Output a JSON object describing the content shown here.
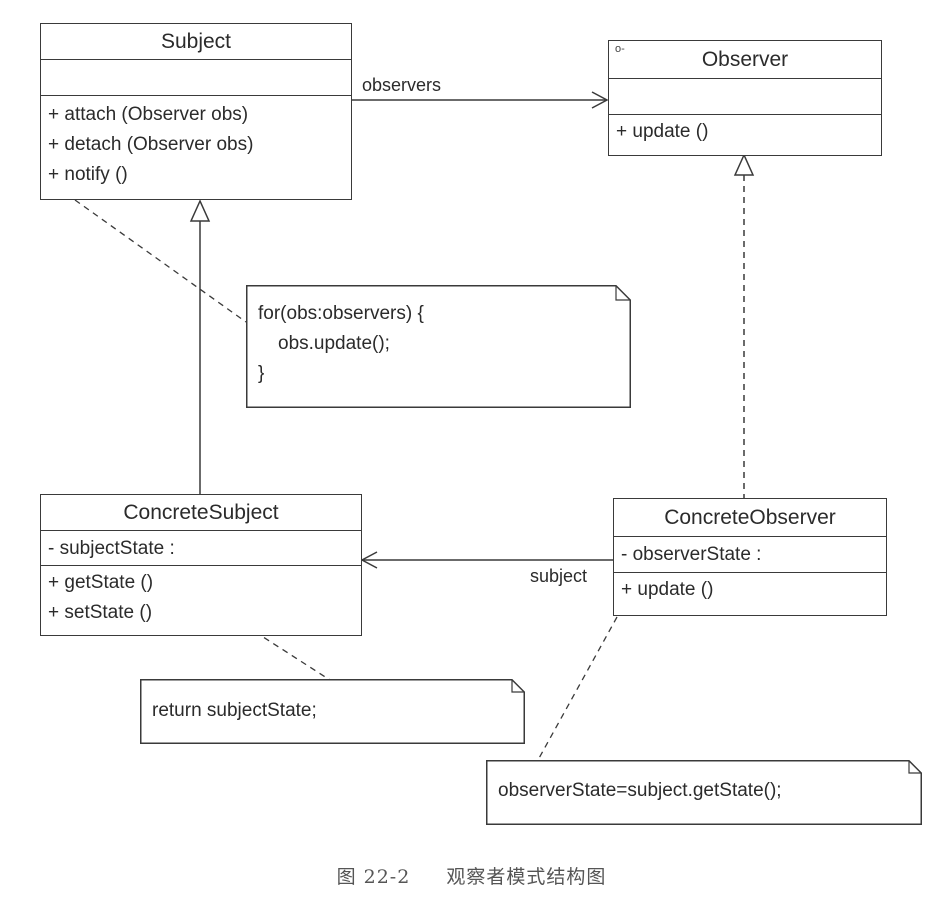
{
  "subject": {
    "name": "Subject",
    "operations": [
      "+ attach (Observer obs)",
      "+ detach (Observer obs)",
      "+ notify ()"
    ]
  },
  "observer": {
    "stereotype_glyph": "o-",
    "name": "Observer",
    "operations": [
      "+ update ()"
    ]
  },
  "concrete_subject": {
    "name": "ConcreteSubject",
    "attribute": "- subjectState :",
    "operations": [
      "+ getState ()",
      "+ setState ()"
    ]
  },
  "concrete_observer": {
    "name": "ConcreteObserver",
    "attribute": "- observerState :",
    "operations": [
      "+ update ()"
    ]
  },
  "associations": {
    "observers_label": "observers",
    "subject_label": "subject"
  },
  "notes": {
    "notify_code": [
      "for(obs:observers) {",
      "    obs.update();",
      "}"
    ],
    "get_state_code": "return subjectState;",
    "observer_update_code": "observerState=subject.getState();"
  },
  "caption": {
    "figure_number": "图 22-2",
    "title": "观察者模式结构图"
  },
  "colors": {
    "line": "#3a3a3a",
    "text": "#2b2b2b",
    "caption": "#555555"
  }
}
